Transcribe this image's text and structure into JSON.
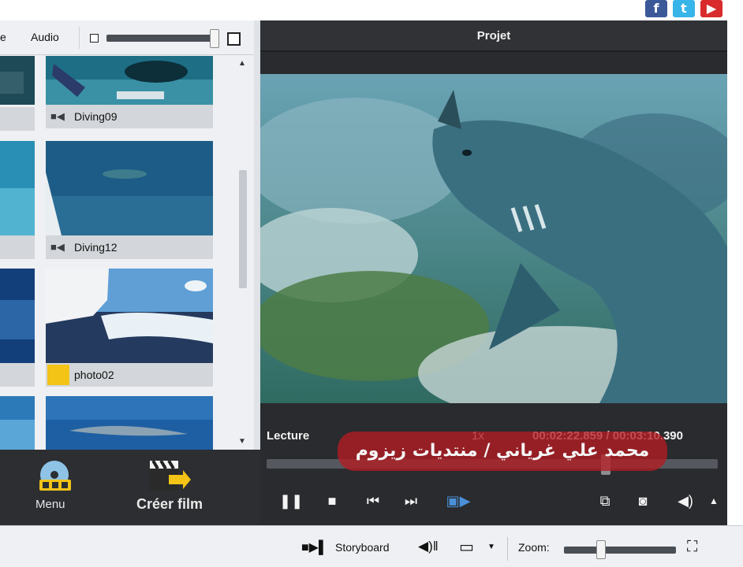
{
  "social": {
    "facebook_icon": "f",
    "twitter_icon": "t",
    "youtube_icon": "▶"
  },
  "media_browser": {
    "tabs": [
      "e",
      "Audio"
    ],
    "thumbnails": [
      {
        "caption": "Diving09",
        "type_icon": "video-camera-icon"
      },
      {
        "caption": "Diving12",
        "type_icon": "video-camera-icon"
      },
      {
        "caption": "photo02",
        "type_icon": "photo-icon"
      }
    ]
  },
  "preview": {
    "header_title": "Projet",
    "status_label": "Lecture",
    "speed": "1x",
    "time_display": "00:02:22.859 / 00:03:10.390",
    "playback_progress": 0.75,
    "watermark_text": "محمد علي غرياني / منتديات زيزوم"
  },
  "left_toolbar": {
    "menu_label": "Menu",
    "create_film_label": "Créer film"
  },
  "bottom_bar": {
    "storyboard_label": "Storyboard",
    "zoom_label": "Zoom:",
    "zoom_level": 0.3
  },
  "colors": {
    "panel_dark": "#2c2e31",
    "panel_light": "#eef0f3",
    "accent_photo": "#f3c316",
    "watermark_red": "#b41c22"
  }
}
